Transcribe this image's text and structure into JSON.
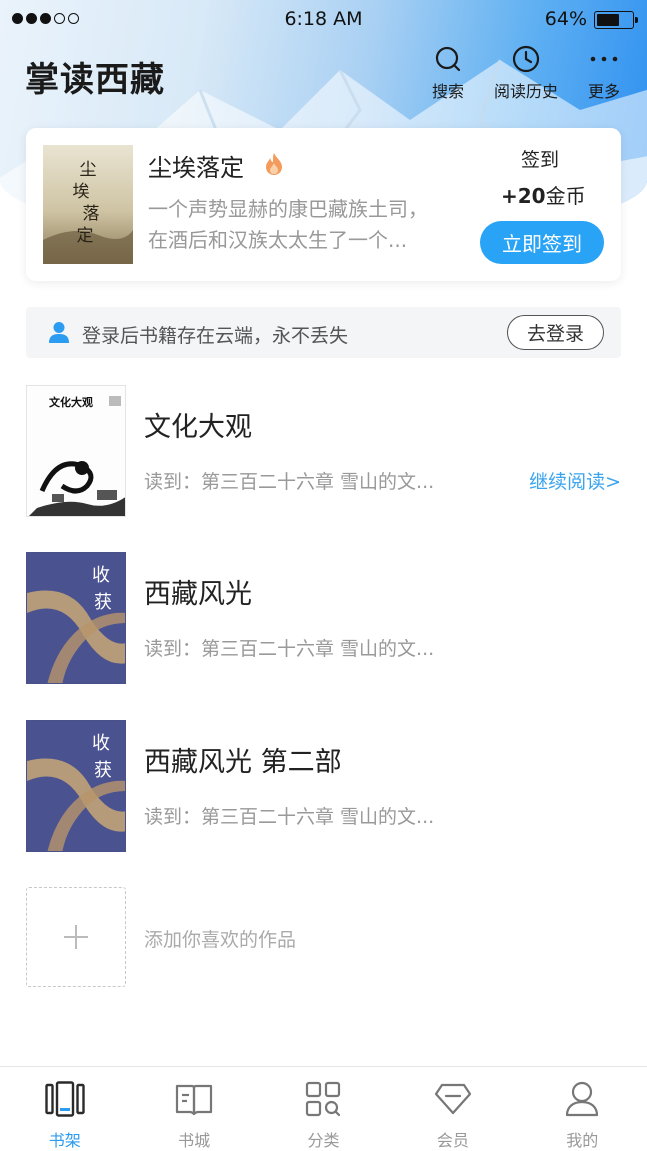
{
  "status_bar": {
    "time": "6:18 AM",
    "battery": "64%"
  },
  "header": {
    "app_title": "掌读西藏",
    "actions": [
      {
        "label": "搜索",
        "icon": "search-icon"
      },
      {
        "label": "阅读历史",
        "icon": "clock-icon"
      },
      {
        "label": "更多",
        "icon": "more-icon"
      }
    ]
  },
  "featured": {
    "title": "尘埃落定",
    "desc_line1": "一个声势显赫的康巴藏族土司，",
    "desc_line2": "在酒后和汉族太太生了一个...",
    "checkin_label": "签到",
    "reward_amount": "+20",
    "reward_unit": "金币",
    "checkin_button": "立即签到",
    "cover_text": "尘埃落定"
  },
  "login_banner": {
    "message": "登录后书籍存在云端，永不丢失",
    "button": "去登录"
  },
  "books": [
    {
      "title": "文化大观",
      "progress": "读到：第三百二十六章  雪山的文...",
      "continue": "继续阅读>",
      "cover_text": "文化大观"
    },
    {
      "title": "西藏风光",
      "progress": "读到：第三百二十六章  雪山的文...",
      "cover_text": "收获"
    },
    {
      "title": "西藏风光 第二部",
      "progress": "读到：第三百二十六章  雪山的文...",
      "cover_text": "收获"
    }
  ],
  "add_item": {
    "label": "添加你喜欢的作品"
  },
  "tabs": [
    {
      "label": "书架",
      "icon": "bookshelf-icon",
      "active": true
    },
    {
      "label": "书城",
      "icon": "book-store-icon",
      "active": false
    },
    {
      "label": "分类",
      "icon": "category-icon",
      "active": false
    },
    {
      "label": "会员",
      "icon": "diamond-icon",
      "active": false
    },
    {
      "label": "我的",
      "icon": "profile-icon",
      "active": false
    }
  ],
  "colors": {
    "accent": "#29a3f5",
    "tab_active": "#2c9cf0",
    "link": "#3aa4ee"
  }
}
